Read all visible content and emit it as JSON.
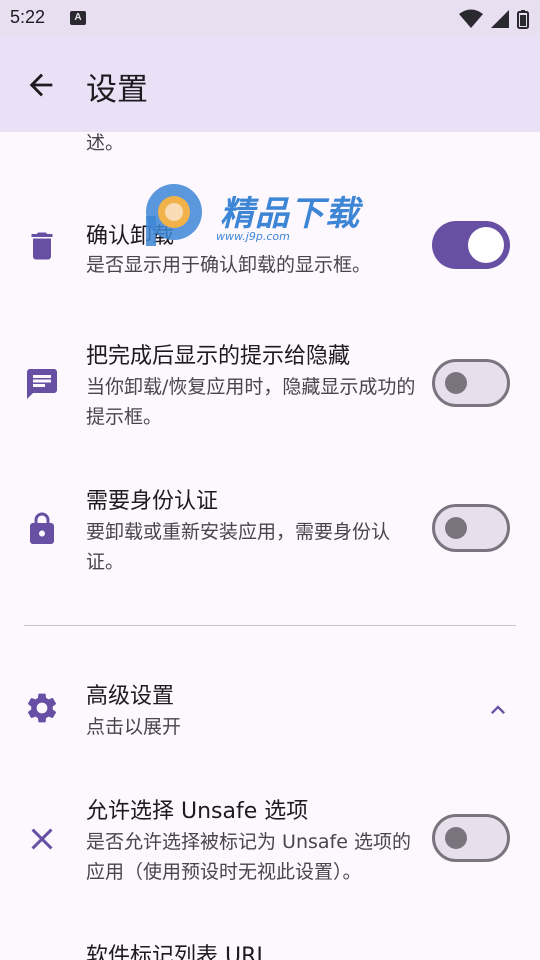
{
  "status_bar": {
    "time": "5:22",
    "notification_letter": "A"
  },
  "app_bar": {
    "title": "设置"
  },
  "partial_text": "述。",
  "settings": [
    {
      "title": "确认卸载",
      "description": "是否显示用于确认卸载的显示框。",
      "icon": "trash-icon",
      "toggle": true
    },
    {
      "title": "把完成后显示的提示给隐藏",
      "description": "当你卸载/恢复应用时，隐藏显示成功的提示框。",
      "icon": "message-icon",
      "toggle": false
    },
    {
      "title": "需要身份认证",
      "description": "要卸载或重新安装应用，需要身份认证。",
      "icon": "lock-icon",
      "toggle": false
    }
  ],
  "advanced": {
    "title": "高级设置",
    "description": "点击以展开",
    "icon": "gear-icon"
  },
  "unsafe": {
    "title": "允许选择 Unsafe 选项",
    "description": "是否允许选择被标记为 Unsafe 选项的应用（使用预设时无视此设置）。",
    "icon": "close-icon",
    "toggle": false
  },
  "list_url": {
    "title": "软件标记列表 URL"
  },
  "watermark": {
    "text": "精品下载",
    "url": "www.j9p.com"
  },
  "colors": {
    "accent": "#6750a4",
    "app_bar": "#ebe1f6",
    "background": "#fdf7fe"
  }
}
